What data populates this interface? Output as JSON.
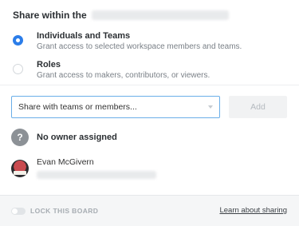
{
  "share": {
    "title": "Share within the"
  },
  "options": [
    {
      "label": "Individuals and Teams",
      "description": "Grant access to selected workspace members and teams.",
      "selected": true
    },
    {
      "label": "Roles",
      "description": "Grant access to makers, contributors, or viewers.",
      "selected": false
    }
  ],
  "select": {
    "placeholder": "Share with teams or members..."
  },
  "add_button": {
    "label": "Add"
  },
  "owner": {
    "icon_text": "?",
    "label": "No owner assigned"
  },
  "member": {
    "name": "Evan McGivern"
  },
  "footer": {
    "lock_label": "LOCK THIS BOARD",
    "learn_link": "Learn about sharing"
  },
  "colors": {
    "accent": "#2b7de9",
    "select_border": "#6aaee8",
    "footer_bg": "#f5f6f7"
  },
  "icons": {
    "owner": "question-icon",
    "select": "chevron-down-icon"
  }
}
